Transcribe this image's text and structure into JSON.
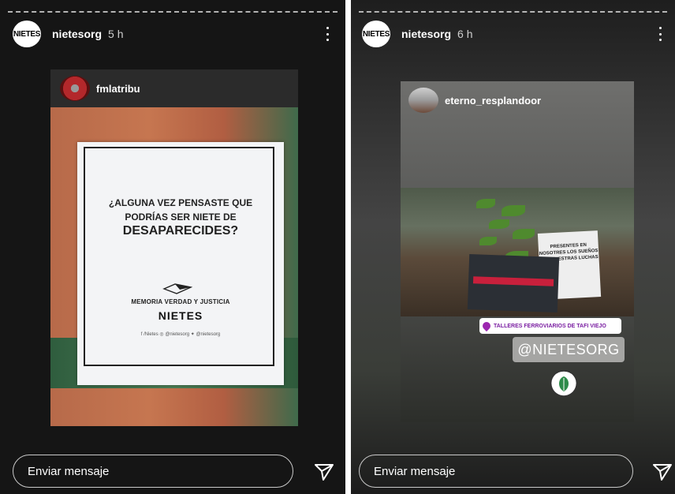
{
  "story_left": {
    "username": "nietesorg",
    "time": "5 h",
    "avatar_text": "NIETES",
    "repost_username": "fmlatribu",
    "poster": {
      "question_line1": "¿ALGUNA VEZ PENSASTE QUE",
      "question_line2": "PODRÍAS SER NIETE DE",
      "question_line3": "DESAPARECIDES?",
      "subtitle": "MEMORIA VERDAD Y JUSTICIA",
      "org": "NIETES",
      "social": "f /Nietes   ◎ @nietesorg   ✦ @nietesorg"
    },
    "message_placeholder": "Enviar mensaje",
    "icons": {
      "more": "more-vertical-icon",
      "send": "send-icon"
    }
  },
  "story_right": {
    "username": "nietesorg",
    "time": "6 h",
    "avatar_text": "NIETES",
    "repost_username": "eterno_resplandoor",
    "sign_text": "PRESENTES EN NOSOTRES LOS SUEÑOS SON NUESTRAS LUCHAS",
    "location": "TALLERES FERROVIARIOS DE TAFI VIEJO",
    "mention": "@NIETESORG",
    "message_placeholder": "Enviar mensaje",
    "icons": {
      "more": "more-vertical-icon",
      "send": "send-icon"
    }
  },
  "colors": {
    "location_text": "#7b1fa2",
    "sign_red": "#c8203c"
  }
}
